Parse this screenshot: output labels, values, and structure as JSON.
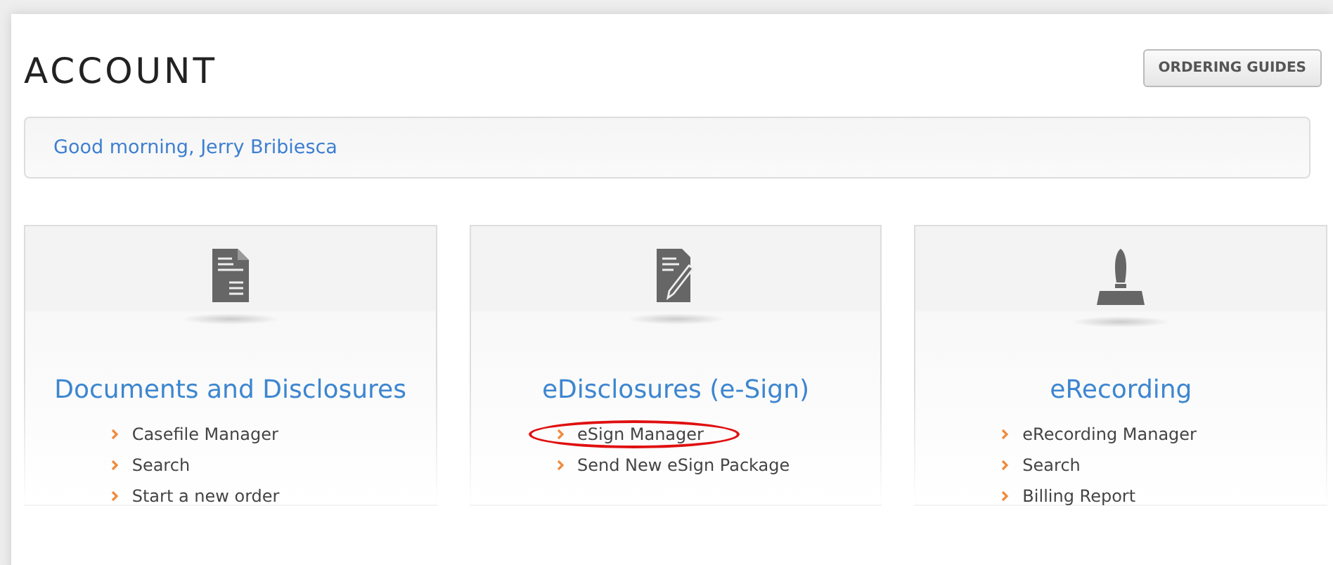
{
  "page": {
    "title": "ACCOUNT",
    "button": "ORDERING GUIDES"
  },
  "greeting": "Good morning, Jerry Bribiesca",
  "cards": [
    {
      "kind": "document",
      "title": "Documents and Disclosures",
      "links": [
        {
          "label": "Casefile Manager",
          "highlighted": false
        },
        {
          "label": "Search",
          "highlighted": false
        },
        {
          "label": "Start a new order",
          "highlighted": false
        }
      ]
    },
    {
      "kind": "signature",
      "title": "eDisclosures (e-Sign)",
      "links": [
        {
          "label": "eSign Manager",
          "highlighted": true
        },
        {
          "label": "Send New eSign Package",
          "highlighted": false
        }
      ]
    },
    {
      "kind": "stamp",
      "title": "eRecording",
      "links": [
        {
          "label": "eRecording Manager",
          "highlighted": false
        },
        {
          "label": "Search",
          "highlighted": false
        },
        {
          "label": "Billing Report",
          "highlighted": false
        }
      ]
    }
  ]
}
